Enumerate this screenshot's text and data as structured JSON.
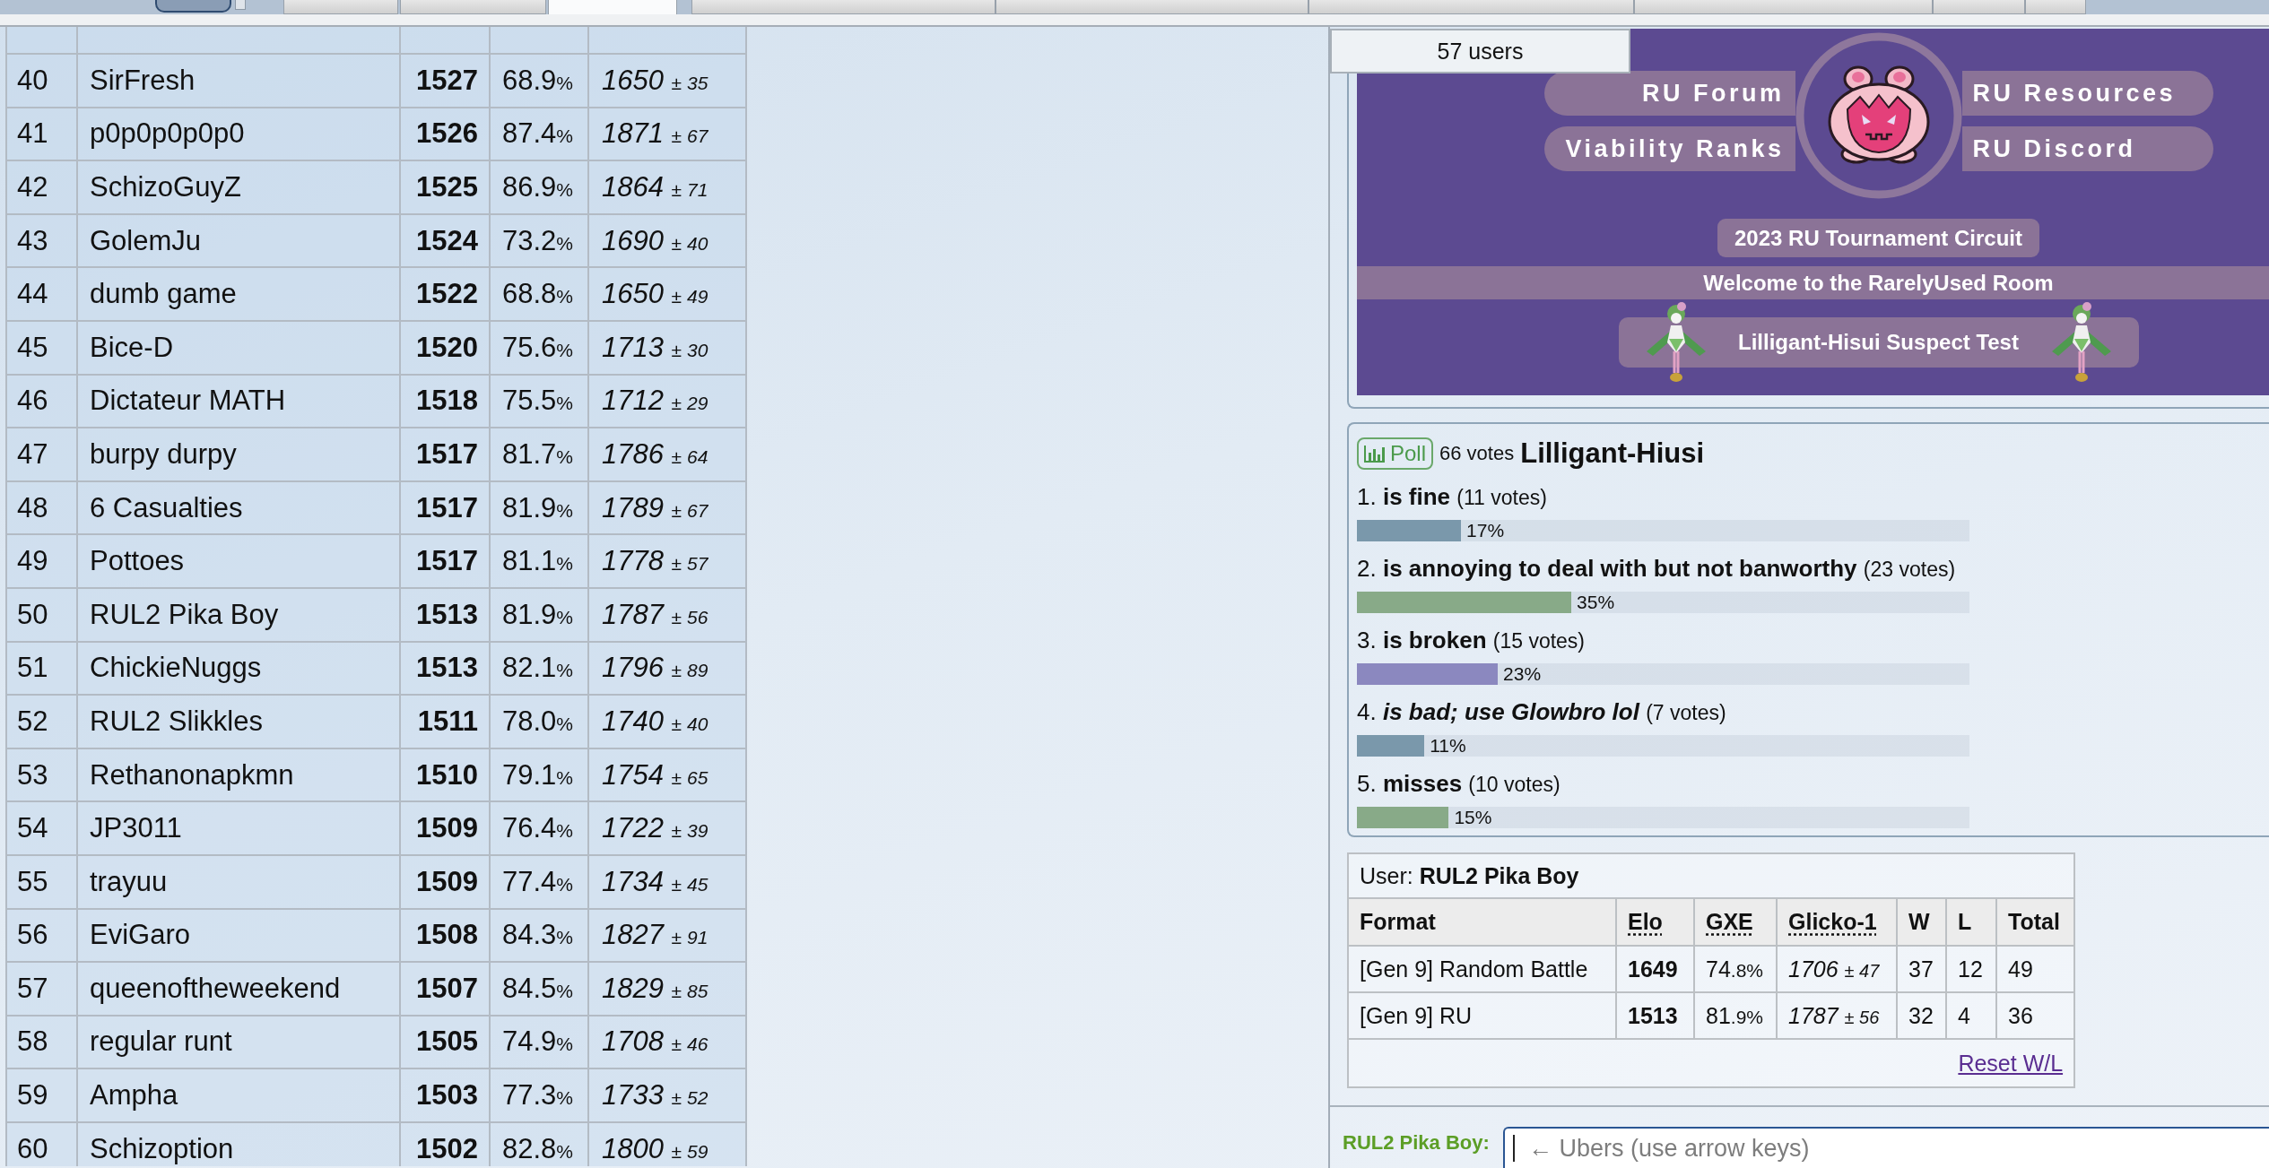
{
  "header": {
    "tabs": [
      {
        "selected": false
      },
      {
        "selected": false
      },
      {
        "selected": true
      },
      {
        "selected": false
      },
      {
        "selected": false
      },
      {
        "selected": false
      },
      {
        "selected": false
      },
      {
        "selected": false
      },
      {
        "selected": false
      }
    ]
  },
  "ladder": {
    "rows": [
      {
        "rank": "40",
        "name": "SirFresh",
        "elo": "1527",
        "gxe": {
          "value": "68.9",
          "unit": "%"
        },
        "glicko": {
          "rating": "1650",
          "deviation": "± 35"
        }
      },
      {
        "rank": "41",
        "name": "p0p0p0p0p0",
        "elo": "1526",
        "gxe": {
          "value": "87.4",
          "unit": "%"
        },
        "glicko": {
          "rating": "1871",
          "deviation": "± 67"
        }
      },
      {
        "rank": "42",
        "name": "SchizoGuyZ",
        "elo": "1525",
        "gxe": {
          "value": "86.9",
          "unit": "%"
        },
        "glicko": {
          "rating": "1864",
          "deviation": "± 71"
        }
      },
      {
        "rank": "43",
        "name": "GolemJu",
        "elo": "1524",
        "gxe": {
          "value": "73.2",
          "unit": "%"
        },
        "glicko": {
          "rating": "1690",
          "deviation": "± 40"
        }
      },
      {
        "rank": "44",
        "name": "dumb game",
        "elo": "1522",
        "gxe": {
          "value": "68.8",
          "unit": "%"
        },
        "glicko": {
          "rating": "1650",
          "deviation": "± 49"
        }
      },
      {
        "rank": "45",
        "name": "Bice-D",
        "elo": "1520",
        "gxe": {
          "value": "75.6",
          "unit": "%"
        },
        "glicko": {
          "rating": "1713",
          "deviation": "± 30"
        }
      },
      {
        "rank": "46",
        "name": "Dictateur MATH",
        "elo": "1518",
        "gxe": {
          "value": "75.5",
          "unit": "%"
        },
        "glicko": {
          "rating": "1712",
          "deviation": "± 29"
        }
      },
      {
        "rank": "47",
        "name": "burpy durpy",
        "elo": "1517",
        "gxe": {
          "value": "81.7",
          "unit": "%"
        },
        "glicko": {
          "rating": "1786",
          "deviation": "± 64"
        }
      },
      {
        "rank": "48",
        "name": "6 Casualties",
        "elo": "1517",
        "gxe": {
          "value": "81.9",
          "unit": "%"
        },
        "glicko": {
          "rating": "1789",
          "deviation": "± 67"
        }
      },
      {
        "rank": "49",
        "name": "Pottoes",
        "elo": "1517",
        "gxe": {
          "value": "81.1",
          "unit": "%"
        },
        "glicko": {
          "rating": "1778",
          "deviation": "± 57"
        }
      },
      {
        "rank": "50",
        "name": "RUL2 Pika Boy",
        "elo": "1513",
        "gxe": {
          "value": "81.9",
          "unit": "%"
        },
        "glicko": {
          "rating": "1787",
          "deviation": "± 56"
        }
      },
      {
        "rank": "51",
        "name": "ChickieNuggs",
        "elo": "1513",
        "gxe": {
          "value": "82.1",
          "unit": "%"
        },
        "glicko": {
          "rating": "1796",
          "deviation": "± 89"
        }
      },
      {
        "rank": "52",
        "name": "RUL2 Slikkles",
        "elo": "1511",
        "gxe": {
          "value": "78.0",
          "unit": "%"
        },
        "glicko": {
          "rating": "1740",
          "deviation": "± 40"
        }
      },
      {
        "rank": "53",
        "name": "Rethanonapkmn",
        "elo": "1510",
        "gxe": {
          "value": "79.1",
          "unit": "%"
        },
        "glicko": {
          "rating": "1754",
          "deviation": "± 65"
        }
      },
      {
        "rank": "54",
        "name": "JP3011",
        "elo": "1509",
        "gxe": {
          "value": "76.4",
          "unit": "%"
        },
        "glicko": {
          "rating": "1722",
          "deviation": "± 39"
        }
      },
      {
        "rank": "55",
        "name": "trayuu",
        "elo": "1509",
        "gxe": {
          "value": "77.4",
          "unit": "%"
        },
        "glicko": {
          "rating": "1734",
          "deviation": "± 45"
        }
      },
      {
        "rank": "56",
        "name": "EviGaro",
        "elo": "1508",
        "gxe": {
          "value": "84.3",
          "unit": "%"
        },
        "glicko": {
          "rating": "1827",
          "deviation": "± 91"
        }
      },
      {
        "rank": "57",
        "name": "queenoftheweekend",
        "elo": "1507",
        "gxe": {
          "value": "84.5",
          "unit": "%"
        },
        "glicko": {
          "rating": "1829",
          "deviation": "± 85"
        }
      },
      {
        "rank": "58",
        "name": "regular runt",
        "elo": "1505",
        "gxe": {
          "value": "74.9",
          "unit": "%"
        },
        "glicko": {
          "rating": "1708",
          "deviation": "± 46"
        }
      },
      {
        "rank": "59",
        "name": "Ampha",
        "elo": "1503",
        "gxe": {
          "value": "77.3",
          "unit": "%"
        },
        "glicko": {
          "rating": "1733",
          "deviation": "± 52"
        }
      },
      {
        "rank": "60",
        "name": "Schizoption",
        "elo": "1502",
        "gxe": {
          "value": "82.8",
          "unit": "%"
        },
        "glicko": {
          "rating": "1800",
          "deviation": "± 59"
        }
      }
    ]
  },
  "userlist": {
    "count": "57 users"
  },
  "room_intro": {
    "link_rows": [
      [
        "RU Forum",
        "RU Resources"
      ],
      [
        "Viability Ranks",
        "RU Discord"
      ]
    ],
    "circuit": "2023 RU Tournament Circuit",
    "welcome": "Welcome to the RarelyUsed Room",
    "suspect": "Lilligant-Hisui Suspect Test"
  },
  "poll": {
    "badge": "Poll",
    "votes": "66 votes",
    "title": "Lilligant-Hiusi",
    "options": [
      {
        "number": "1.",
        "text": "is fine",
        "italic": false,
        "votes": "(11 votes)",
        "level": 0.17,
        "percent": "17%",
        "color": "#7a98ab"
      },
      {
        "number": "2.",
        "text": "is annoying to deal with but not banworthy",
        "italic": false,
        "votes": "(23 votes)",
        "level": 0.35,
        "percent": "35%",
        "color": "#88aa88"
      },
      {
        "number": "3.",
        "text": "is broken",
        "italic": false,
        "votes": "(15 votes)",
        "level": 0.23,
        "percent": "23%",
        "color": "#8b88bf"
      },
      {
        "number": "4.",
        "text": "is bad; use Glowbro lol",
        "italic": true,
        "votes": "(7 votes)",
        "level": 0.11,
        "percent": "11%",
        "color": "#7a98ab"
      },
      {
        "number": "5.",
        "text": "misses",
        "italic": false,
        "votes": "(10 votes)",
        "level": 0.15,
        "percent": "15%",
        "color": "#88aa88"
      }
    ]
  },
  "user_stats": {
    "label": "User:",
    "username": "RUL2 Pika Boy",
    "columns": [
      {
        "name": "Format",
        "dotted": false
      },
      {
        "name": "Elo",
        "dotted": true
      },
      {
        "name": "GXE",
        "dotted": true
      },
      {
        "name": "Glicko-1",
        "dotted": true
      },
      {
        "name": "W",
        "dotted": false
      },
      {
        "name": "L",
        "dotted": false
      },
      {
        "name": "Total",
        "dotted": false
      }
    ],
    "rows": [
      {
        "format": "[Gen 9] Random Battle",
        "elo": "1649",
        "gxe": {
          "whole": "74",
          "fraction": ".8%"
        },
        "glicko": {
          "rating": "1706",
          "deviation": "± 47"
        },
        "w": "37",
        "l": "12",
        "total": "49"
      },
      {
        "format": "[Gen 9] RU",
        "elo": "1513",
        "gxe": {
          "whole": "81",
          "fraction": ".9%"
        },
        "glicko": {
          "rating": "1787",
          "deviation": "± 56"
        },
        "w": "32",
        "l": "4",
        "total": "36"
      }
    ],
    "reset_link": "Reset W/L"
  },
  "chat_input": {
    "name": "RUL2 Pika Boy:",
    "placeholder": "← Ubers (use arrow keys)"
  }
}
